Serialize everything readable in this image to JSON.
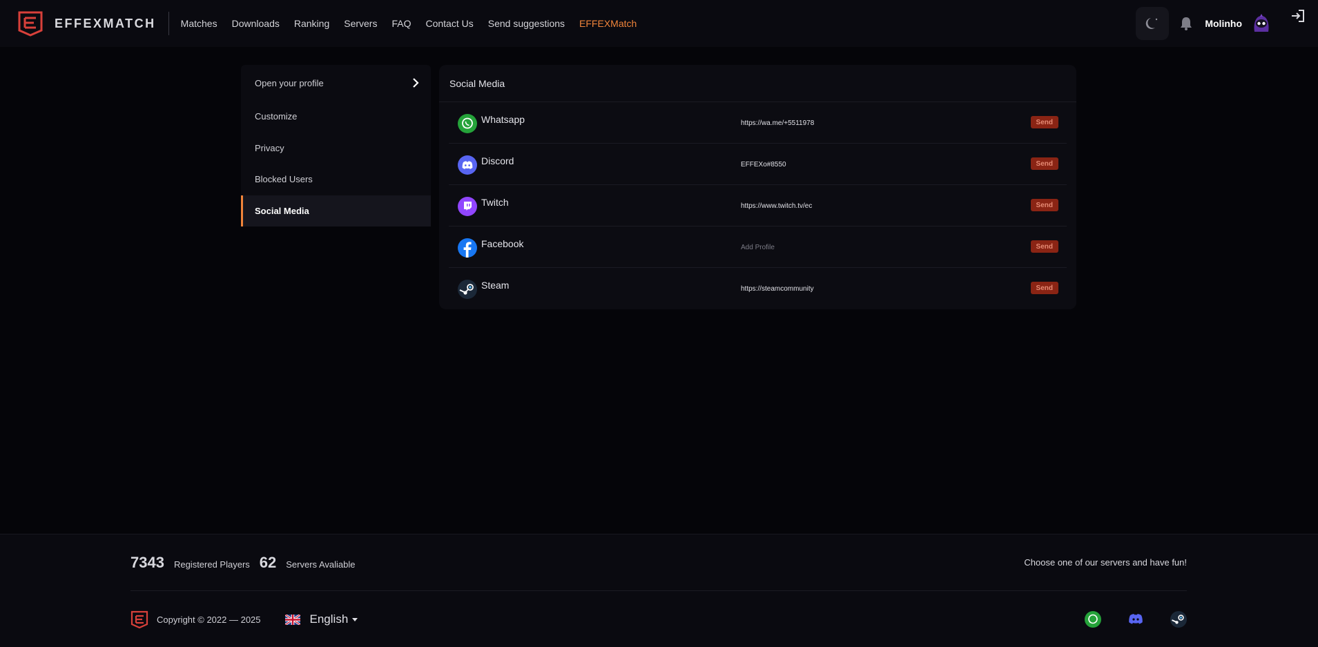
{
  "header": {
    "brand": "EFFEXMATCH",
    "nav": [
      {
        "label": "Matches"
      },
      {
        "label": "Downloads"
      },
      {
        "label": "Ranking"
      },
      {
        "label": "Servers"
      },
      {
        "label": "FAQ"
      },
      {
        "label": "Contact Us"
      },
      {
        "label": "Send suggestions"
      },
      {
        "label": "EFFEXMatch",
        "accent": "#f0843a"
      }
    ],
    "username": "Molinho"
  },
  "sidebar": {
    "items": [
      {
        "label": "Open your profile",
        "icon": "chevron-right-icon"
      },
      {
        "label": "Customize"
      },
      {
        "label": "Privacy"
      },
      {
        "label": "Blocked Users"
      },
      {
        "label": "Social Media",
        "active": true
      }
    ]
  },
  "social": {
    "title": "Social Media",
    "send_label": "Send",
    "rows": [
      {
        "name": "Whatsapp",
        "icon": "whatsapp-icon",
        "value": "https://wa.me/+5511978",
        "color": "#25a33a"
      },
      {
        "name": "Discord",
        "icon": "discord-icon",
        "value": "EFFEXo#8550",
        "color": "#5865f2"
      },
      {
        "name": "Twitch",
        "icon": "twitch-icon",
        "value": "https://www.twitch.tv/ec",
        "color": "#9146ff"
      },
      {
        "name": "Facebook",
        "icon": "facebook-icon",
        "value": "Add Profile",
        "placeholder": true,
        "color": "#1877f2"
      },
      {
        "name": "Steam",
        "icon": "steam-icon",
        "value": "https://steamcommunity",
        "color": "#1b2838"
      }
    ]
  },
  "footer": {
    "registered_count": "7343",
    "registered_label": "Registered Players",
    "servers_count": "62",
    "servers_label": "Servers Avaliable",
    "tagline": "Choose one of our servers and have fun!",
    "copyright": "Copyright © 2022 — 2025",
    "language": "English"
  },
  "colors": {
    "accent": "#f0843a",
    "send_button": "#8a2414"
  }
}
